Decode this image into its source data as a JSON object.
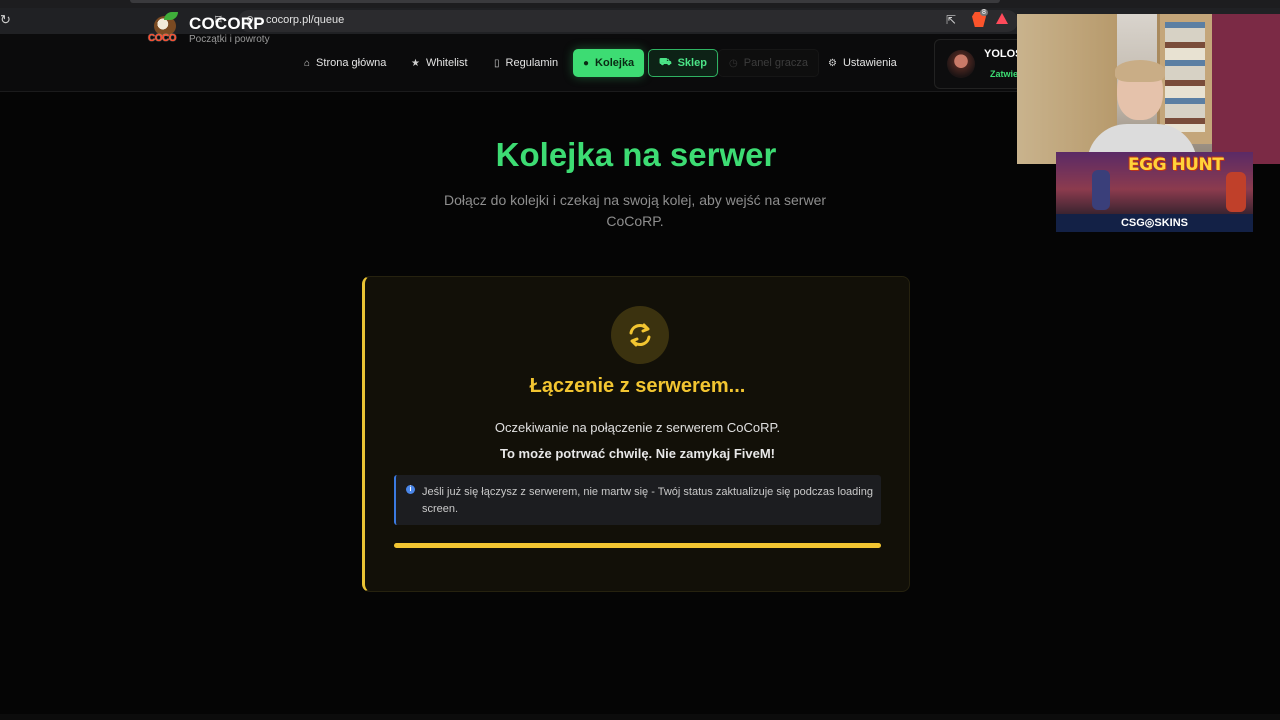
{
  "browser": {
    "url": "cocorp.pl/queue",
    "extension_badge": "8"
  },
  "site": {
    "brand": "COCORP",
    "tagline": "Początki i powroty",
    "logo_text": "COCO"
  },
  "nav": {
    "items": [
      {
        "label": "Strona główna",
        "icon": "home-icon"
      },
      {
        "label": "Whitelist",
        "icon": "star-icon"
      },
      {
        "label": "Regulamin",
        "icon": "document-icon"
      },
      {
        "label": "Kolejka",
        "icon": "user-icon"
      },
      {
        "label": "Sklep",
        "icon": "cart-icon"
      },
      {
        "label": "Panel gracza",
        "icon": "clock-icon"
      },
      {
        "label": "Ustawienia",
        "icon": "gear-icon"
      }
    ]
  },
  "user": {
    "name": "YOLOS",
    "status": "Zatwie"
  },
  "overlay": {
    "ad_title": "EGG HUNT",
    "ad_brand": "CSG◎SKINS"
  },
  "hero": {
    "title": "Kolejka na serwer",
    "subtitle": "Dołącz do kolejki i czekaj na swoją kolej, aby wejść na serwer CoCoRP."
  },
  "card": {
    "title": "Łączenie z serwerem...",
    "line1": "Oczekiwanie na połączenie z serwerem CoCoRP.",
    "line2": "To może potrwać chwilę. Nie zamykaj FiveM!",
    "info": "Jeśli już się łączysz z serwerem, nie martw się - Twój status zaktualizuje się podczas loading screen.",
    "progress": 1.0
  },
  "colors": {
    "accent_green": "#3ddc73",
    "accent_yellow": "#f2c531",
    "info_blue": "#4a86e8",
    "background": "#050505"
  }
}
